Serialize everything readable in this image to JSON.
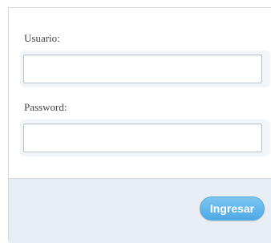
{
  "form": {
    "username_label": "Usuario:",
    "username_value": "",
    "password_label": "Password:",
    "password_value": "",
    "submit_label": "Ingresar"
  },
  "colors": {
    "footer_background": "#e8eef4",
    "button_gradient_top": "#7cc6f1",
    "button_gradient_bottom": "#4ea9e6"
  }
}
